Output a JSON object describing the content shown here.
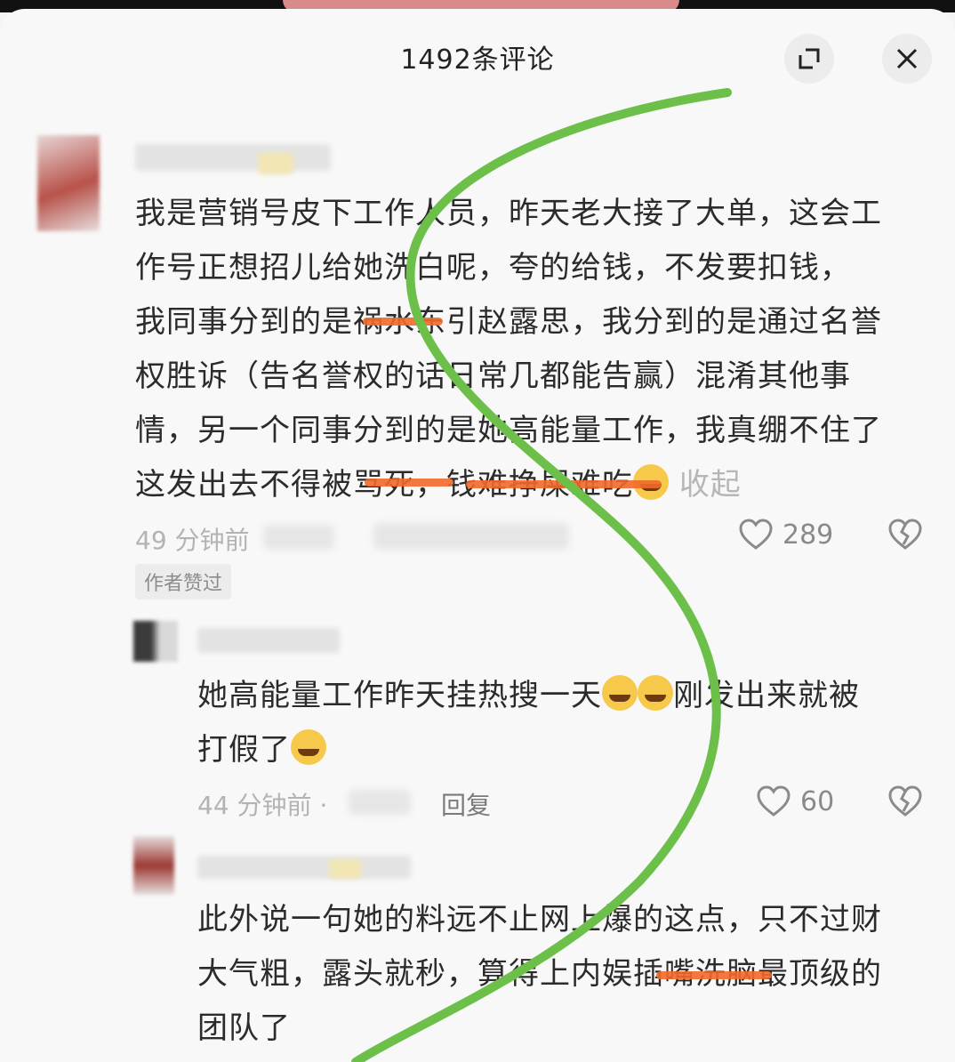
{
  "header": {
    "title": "1492条评论"
  },
  "comments": [
    {
      "lines": [
        "我是营销号皮下工作人员，昨天老大接了大单，这会工",
        "作号正想招儿给她洗白呢，夸的给钱，不发要扣钱，",
        "我同事分到的是祸水东引赵露思，我分到的是通过名誉",
        "权胜诉（告名誉权的话日常几都能告赢）混淆其他事",
        "情，另一个同事分到的是她高能量工作，我真绷不住了",
        "这发出去不得被骂死，钱难挣屎难吃"
      ],
      "collapse_label": "收起",
      "time": "49 分钟前",
      "likes": "289",
      "badge": "作者赞过"
    },
    {
      "lines": [
        "她高能量工作昨天挂热搜一天",
        "打假了"
      ],
      "tail": "刚发出来就被",
      "time": "44 分钟前 ·",
      "reply_label": "回复",
      "likes": "60"
    },
    {
      "lines": [
        "此外说一句她的料远不止网上爆的这点，只不过财",
        "大气粗，露头就秒，算得上内娱插嘴洗脑最顶级的",
        "团队了"
      ]
    }
  ],
  "icons": [
    "expand-icon",
    "close-icon",
    "heart-icon",
    "broken-heart-icon"
  ],
  "colors": {
    "annotation_curve": "#6cc04a",
    "scribble": "#f06a2a"
  }
}
